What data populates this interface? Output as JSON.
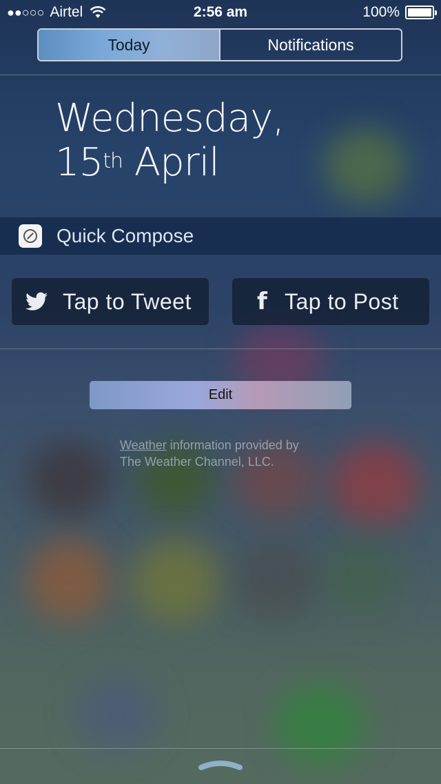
{
  "status_bar": {
    "signal": "●●○○○",
    "carrier": "Airtel",
    "time": "2:56 am",
    "battery_percent": "100%"
  },
  "tabs": [
    {
      "label": "Today",
      "selected": true
    },
    {
      "label": "Notifications",
      "selected": false
    }
  ],
  "date": {
    "weekday": "Wednesday,",
    "day_number": "15",
    "day_suffix": "th",
    "month": "April"
  },
  "quick_compose": {
    "title": "Quick Compose",
    "tweet_label": "Tap to Tweet",
    "post_label": "Tap to Post"
  },
  "edit_label": "Edit",
  "credits": {
    "link_text": "Weather",
    "line1_rest": " information provided by",
    "line2": "The Weather Channel, LLC."
  },
  "icons": {
    "wifi": "wifi-icon",
    "battery": "battery-icon",
    "quick_compose_app": "compose-app-icon",
    "twitter": "twitter-icon",
    "facebook": "facebook-icon",
    "grabber": "chevron-up-icon"
  }
}
